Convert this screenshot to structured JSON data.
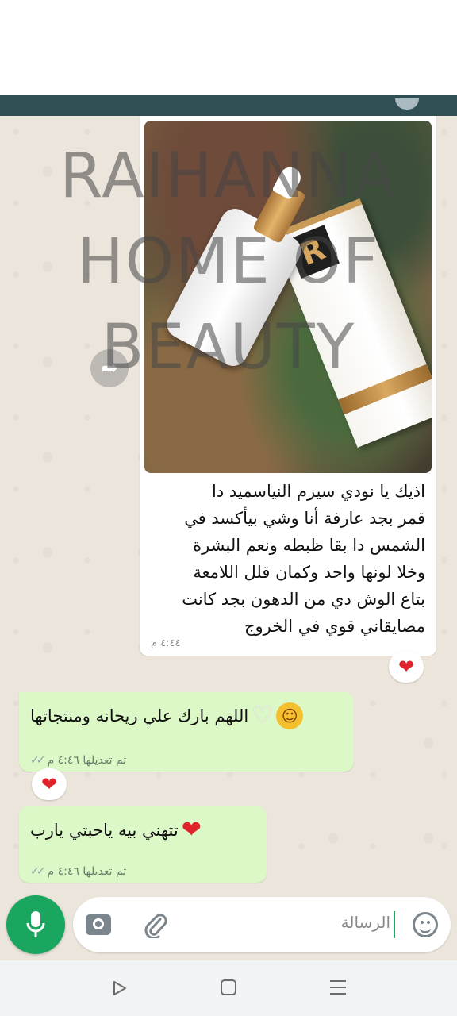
{
  "chat": {
    "messages": [
      {
        "direction": "incoming",
        "type": "image",
        "text": "اذيك يا نودي  سيرم النياسميد دا قمر بجد عارفة أنا وشي بيأكسد في الشمس دا بقا ظبطه ونعم البشرة وخلا لونها واحد وكمان قلل اللامعة بتاع الوش دي من الدهون بجد كانت مصايقاني قوي في الخروج",
        "lines": [
          "اذيك يا نودي  سيرم النياسميد دا",
          "قمر بجد عارفة أنا وشي بيأكسد في",
          "الشمس دا بقا ظبطه ونعم البشرة",
          "وخلا لونها واحد وكمان قلل اللامعة",
          "بتاع الوش دي من الدهون بجد كانت",
          "مصايقاني قوي في الخروج"
        ],
        "time": "٤:٤٤ م",
        "reaction": "heart"
      },
      {
        "direction": "outgoing",
        "text": "اللهم بارك علي ريحانه ومنتجاتها",
        "emojis": [
          "white-heart",
          "kissing-face"
        ],
        "meta": "تم تعديلها ٤:٤٦ م",
        "status": "read",
        "reaction": "heart"
      },
      {
        "direction": "outgoing",
        "text": "تتهني بيه ياحبتي يارب",
        "emojis": [
          "red-heart"
        ],
        "meta": "تم تعديلها ٤:٤٦ م",
        "status": "read"
      }
    ]
  },
  "watermark": {
    "lines": [
      "RAIHANNA",
      "HOME OF",
      "BEAUTY"
    ]
  },
  "input": {
    "placeholder": "الرسالة"
  },
  "icons": {
    "mic": "mic-icon",
    "camera": "camera-icon",
    "attach": "paperclip-icon",
    "emoji": "emoji-icon",
    "forward": "forward-icon"
  },
  "colors": {
    "accent": "#1aa65e",
    "outgoing_bubble": "#dcf8c6",
    "incoming_bubble": "#ffffff",
    "chat_background": "#ece5dc",
    "header": "#2f4f55",
    "reaction_heart": "#e0222b"
  }
}
